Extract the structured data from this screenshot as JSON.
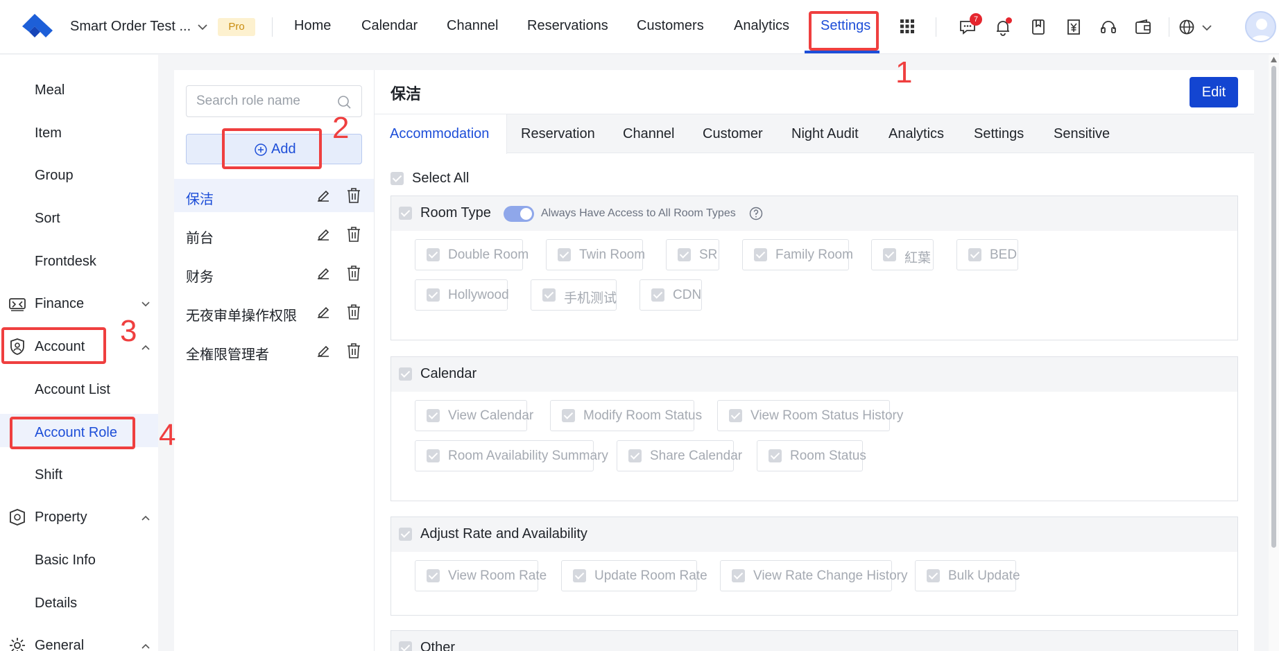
{
  "topbar": {
    "store_name": "Smart Order Test ...",
    "plan_badge": "Pro",
    "nav": [
      "Home",
      "Calendar",
      "Channel",
      "Reservations",
      "Customers",
      "Analytics",
      "Settings"
    ],
    "active_nav": "Settings",
    "message_count": "7",
    "accent_color": "#1d4ed8"
  },
  "sidebar": {
    "items": {
      "meal": "Meal",
      "item": "Item",
      "group": "Group",
      "sort": "Sort",
      "frontdesk": "Frontdesk",
      "finance": "Finance",
      "account": "Account",
      "account_list": "Account List",
      "account_role": "Account Role",
      "shift": "Shift",
      "property": "Property",
      "basic_info": "Basic Info",
      "details": "Details",
      "general": "General"
    },
    "active_item": "Account Role"
  },
  "roles": {
    "search_placeholder": "Search role name",
    "add_label": "Add",
    "list": [
      "保洁",
      "前台",
      "财务",
      "无夜审单操作权限",
      "全権限管理者"
    ],
    "selected": "保洁"
  },
  "detail": {
    "title": "保洁",
    "edit_label": "Edit",
    "tabs": [
      "Accommodation",
      "Reservation",
      "Channel",
      "Customer",
      "Night Audit",
      "Analytics",
      "Settings",
      "Sensitive"
    ],
    "active_tab": "Accommodation",
    "select_all": "Select All",
    "sections": {
      "room_type": {
        "title": "Room Type",
        "toggle_label": "Always Have Access to All Room Types",
        "toggle_on": true,
        "items": [
          "Double Room",
          "Twin Room",
          "SR",
          "Family Room",
          "紅葉",
          "BED",
          "Hollywood",
          "手机测试",
          "CDN"
        ]
      },
      "calendar": {
        "title": "Calendar",
        "items": [
          "View Calendar",
          "Modify Room Status",
          "View Room Status History",
          "Room Availability Summary",
          "Share Calendar",
          "Room Status"
        ]
      },
      "rate": {
        "title": "Adjust Rate and Availability",
        "items": [
          "View Room Rate",
          "Update Room Rate",
          "View Rate Change History",
          "Bulk Update"
        ]
      },
      "other": {
        "title": "Other"
      }
    }
  },
  "annotations": [
    "1",
    "2",
    "3",
    "4"
  ],
  "colors": {
    "annotation": "#ef3f3f",
    "primary_button": "#1345d1"
  }
}
